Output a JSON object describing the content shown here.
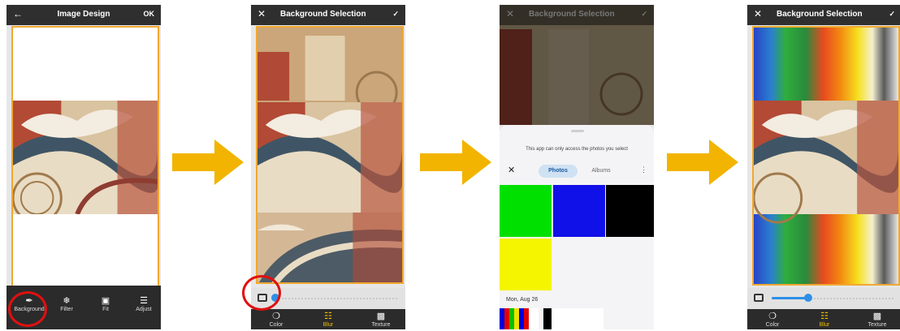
{
  "step1": {
    "title": "Image Design",
    "ok_label": "OK",
    "back_icon": "arrow-left-icon",
    "tools": [
      {
        "label": "Background",
        "icon": "brush-icon"
      },
      {
        "label": "Filter",
        "icon": "filter-icon"
      },
      {
        "label": "Fit",
        "icon": "fit-icon"
      },
      {
        "label": "Adjust",
        "icon": "adjust-icon"
      }
    ]
  },
  "step2": {
    "title": "Background Selection",
    "close_icon": "close-icon",
    "confirm_icon": "check-icon",
    "tabs": [
      {
        "label": "Color",
        "icon": "palette-icon"
      },
      {
        "label": "Blur",
        "icon": "blur-icon"
      },
      {
        "label": "Texture",
        "icon": "texture-icon"
      }
    ],
    "slider_level": 0.0
  },
  "step3": {
    "title": "Background Selection",
    "picker": {
      "notice": "This app can only access the photos you select",
      "tabs": [
        "Photos",
        "Albums"
      ],
      "date_label": "Mon, Aug 26",
      "tile_colors": [
        "#00e000",
        "#1010e8",
        "#000000",
        "#f5f500"
      ]
    }
  },
  "step4": {
    "title": "Background Selection",
    "tabs": [
      {
        "label": "Color",
        "icon": "palette-icon"
      },
      {
        "label": "Blur",
        "icon": "blur-icon"
      },
      {
        "label": "Texture",
        "icon": "texture-icon"
      }
    ],
    "slider_level": 0.3
  },
  "colors": {
    "accent_orange": "#f0a830",
    "arrow_yellow": "#f2b400",
    "highlight_red": "#e01010",
    "slider_blue": "#2f8fe8",
    "active_tab": "#f2c200"
  }
}
